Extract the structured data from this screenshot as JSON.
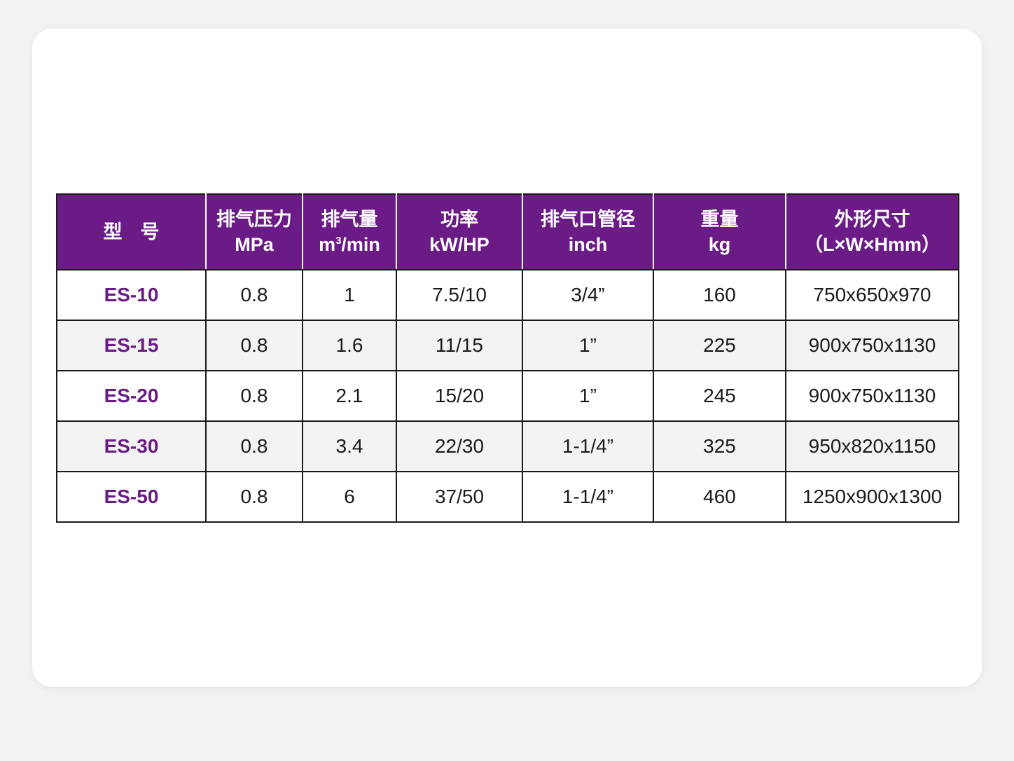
{
  "table": {
    "headers": [
      {
        "line1": "型号",
        "line2": ""
      },
      {
        "line1": "排气压力",
        "line2": "MPa"
      },
      {
        "line1": "排气量",
        "line2_base": "m",
        "line2_sup": "3",
        "line2_rest": "/min"
      },
      {
        "line1": "功率",
        "line2": "kW/HP"
      },
      {
        "line1": "排气口管径",
        "line2": "inch"
      },
      {
        "line1": "重量",
        "line2": "kg"
      },
      {
        "line1": "外形尺寸",
        "line2": "（L×W×Hmm）"
      }
    ],
    "rows": [
      [
        "ES-10",
        "0.8",
        "1",
        "7.5/10",
        "3/4”",
        "160",
        "750x650x970"
      ],
      [
        "ES-15",
        "0.8",
        "1.6",
        "11/15",
        "1”",
        "225",
        "900x750x1130"
      ],
      [
        "ES-20",
        "0.8",
        "2.1",
        "15/20",
        "1”",
        "245",
        "900x750x1130"
      ],
      [
        "ES-30",
        "0.8",
        "3.4",
        "22/30",
        "1-1/4”",
        "325",
        "950x820x1150"
      ],
      [
        "ES-50",
        "0.8",
        "6",
        "37/50",
        "1-1/4”",
        "460",
        "1250x900x1300"
      ]
    ]
  },
  "colors": {
    "header_bg": "#6a1b86",
    "model_text": "#6a1b86",
    "alt_row_bg": "#f3f3f3"
  }
}
